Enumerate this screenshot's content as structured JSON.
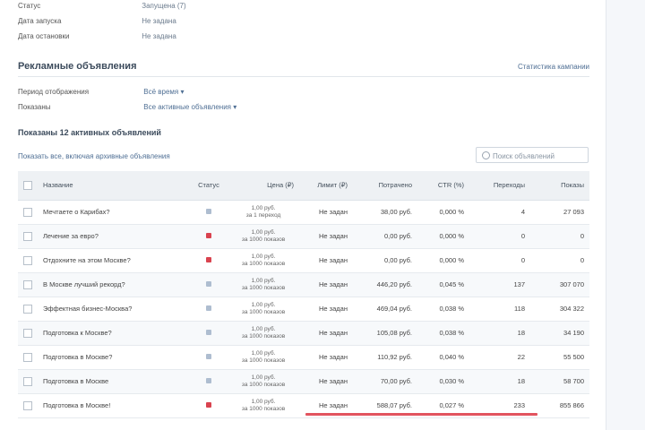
{
  "info": [
    {
      "key": "Статус",
      "value": "Запущена (7)"
    },
    {
      "key": "Дата запуска",
      "value": "Не задана"
    },
    {
      "key": "Дата остановки",
      "value": "Не задана"
    }
  ],
  "ads_section": {
    "title": "Рекламные объявления",
    "link": "Статистика кампании"
  },
  "filters": [
    {
      "key": "Период отображения",
      "value": "Всё время ▾"
    },
    {
      "key": "Показаны",
      "value": "Все активные объявления ▾"
    }
  ],
  "count_title": "Показаны 12 активных объявлений",
  "show_all_link": "Показать все, включая архивные объявления",
  "search": {
    "placeholder": "Поиск объявлений"
  },
  "table": {
    "headers": [
      "Название",
      "Статус",
      "Цена (₽)",
      "Лимит (₽)",
      "Потрачено",
      "CTR (%)",
      "Переходы",
      "Показы"
    ],
    "rows": [
      {
        "name": "Мечтаете о Карибах?",
        "status": "running",
        "price_line1": "1,00 руб.",
        "price_line2": "за 1 переход",
        "limit": "Не задан",
        "spent": "38,00 руб.",
        "ctr": "0,000 %",
        "clicks": "4",
        "impressions": "27 093"
      },
      {
        "name": "Лечение за евро?",
        "status": "stopped",
        "price_line1": "1,00 руб.",
        "price_line2": "за 1000 показов",
        "limit": "Не задан",
        "spent": "0,00 руб.",
        "ctr": "0,000 %",
        "clicks": "0",
        "impressions": "0"
      },
      {
        "name": "Отдохните на этом Москве?",
        "status": "stopped",
        "price_line1": "1,00 руб.",
        "price_line2": "за 1000 показов",
        "limit": "Не задан",
        "spent": "0,00 руб.",
        "ctr": "0,000 %",
        "clicks": "0",
        "impressions": "0"
      },
      {
        "name": "В Москве лучший рекорд?",
        "status": "running",
        "price_line1": "1,00 руб.",
        "price_line2": "за 1000 показов",
        "limit": "Не задан",
        "spent": "446,20 руб.",
        "ctr": "0,045 %",
        "clicks": "137",
        "impressions": "307 070"
      },
      {
        "name": "Эффектная бизнес-Москва?",
        "status": "running",
        "price_line1": "1,00 руб.",
        "price_line2": "за 1000 показов",
        "limit": "Не задан",
        "spent": "469,04 руб.",
        "ctr": "0,038 %",
        "clicks": "118",
        "impressions": "304 322"
      },
      {
        "name": "Подготовка к Москве?",
        "status": "running",
        "price_line1": "1,00 руб.",
        "price_line2": "за 1000 показов",
        "limit": "Не задан",
        "spent": "105,08 руб.",
        "ctr": "0,038 %",
        "clicks": "18",
        "impressions": "34 190"
      },
      {
        "name": "Подготовка в Москве?",
        "status": "running",
        "price_line1": "1,00 руб.",
        "price_line2": "за 1000 показов",
        "limit": "Не задан",
        "spent": "110,92 руб.",
        "ctr": "0,040 %",
        "clicks": "22",
        "impressions": "55 500"
      },
      {
        "name": "Подготовка в Москве",
        "status": "running",
        "price_line1": "1,00 руб.",
        "price_line2": "за 1000 показов",
        "limit": "Не задан",
        "spent": "70,00 руб.",
        "ctr": "0,030 %",
        "clicks": "18",
        "impressions": "58 700"
      },
      {
        "name": "Подготовка в Москве!",
        "status": "stopped",
        "price_line1": "1,00 руб.",
        "price_line2": "за 1000 показов",
        "limit": "Не задан",
        "spent": "588,07 руб.",
        "ctr": "0,027 %",
        "clicks": "233",
        "impressions": "855 866"
      }
    ]
  },
  "colors": {
    "link": "#4f6f94",
    "header_bg": "#eef1f4",
    "stopped": "#d9434f",
    "running": "#aebdd0",
    "highlight": "#e2545f"
  }
}
